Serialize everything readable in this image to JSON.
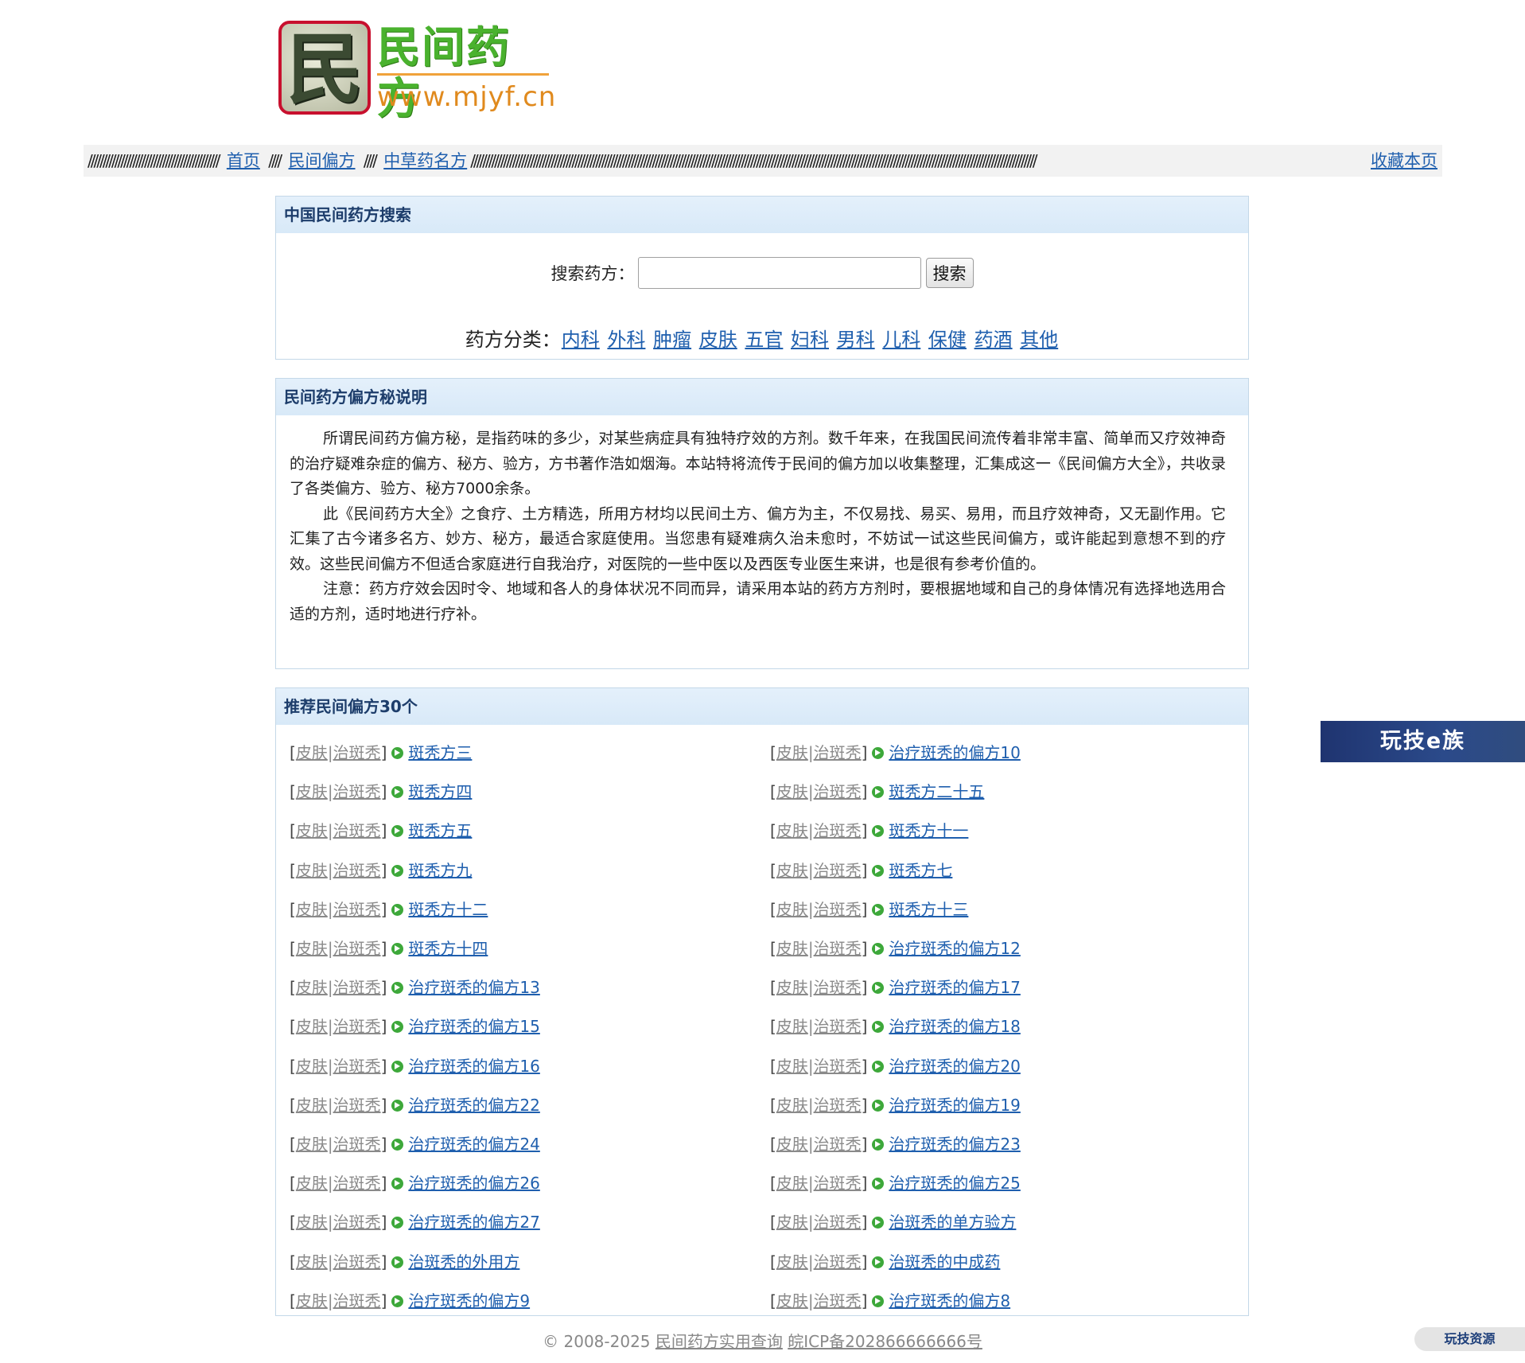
{
  "logo": {
    "char": "民",
    "name": "民间药方",
    "url": "www.mjyf.cn"
  },
  "nav": {
    "slashes_a": "////////////////////////////////////////////",
    "home": "首页",
    "slashes_b": "////",
    "folk_remedies": "民间偏方",
    "slashes_c": "////",
    "herbal": "中草药名方",
    "slashes_d": "//////////////////////////////////////////////////////////////////////////////////////////////////////////////////////////////////////////////////////////////////////////////////////////////",
    "bookmark": "收藏本页"
  },
  "search_panel": {
    "title": "中国民间药方搜索",
    "label": "搜索药方：",
    "input_value": "",
    "button": "搜索",
    "category_label": "药方分类：",
    "categories": [
      "内科",
      "外科",
      "肿瘤",
      "皮肤",
      "五官",
      "妇科",
      "男科",
      "儿科",
      "保健",
      "药酒",
      "其他"
    ]
  },
  "about_panel": {
    "title": "民间药方偏方秘说明",
    "paragraphs": [
      "所谓民间药方偏方秘，是指药味的多少，对某些病症具有独特疗效的方剂。数千年来，在我国民间流传着非常丰富、简单而又疗效神奇的治疗疑难杂症的偏方、秘方、验方，方书著作浩如烟海。本站特将流传于民间的偏方加以收集整理，汇集成这一《民间偏方大全》，共收录了各类偏方、验方、秘方7000余条。",
      "此《民间药方大全》之食疗、土方精选，所用方材均以民间土方、偏方为主，不仅易找、易买、易用，而且疗效神奇，又无副作用。它汇集了古今诸多名方、妙方、秘方，最适合家庭使用。当您患有疑难病久治未愈时，不妨试一试这些民间偏方，或许能起到意想不到的疗效。这些民间偏方不但适合家庭进行自我治疗，对医院的一些中医以及西医专业医生来讲，也是很有参考价值的。",
      "注意：药方疗效会因时令、地域和各人的身体状况不同而异，请采用本站的药方方剂时，要根据地域和自己的身体情况有选择地选用合适的方剂，适时地进行疗补。"
    ]
  },
  "rec_panel": {
    "title": "推荐民间偏方30个",
    "tag_a": "皮肤",
    "tag_sep": "|",
    "tag_b": "治斑秃",
    "bracket_open": "[",
    "bracket_close": "]",
    "left": [
      "斑秃方三",
      "斑秃方四",
      "斑秃方五",
      "斑秃方九",
      "斑秃方十二",
      "斑秃方十四",
      "治疗斑秃的偏方13",
      "治疗斑秃的偏方15",
      "治疗斑秃的偏方16",
      "治疗斑秃的偏方22",
      "治疗斑秃的偏方24",
      "治疗斑秃的偏方26",
      "治疗斑秃的偏方27",
      "治斑秃的外用方",
      "治疗斑秃的偏方9"
    ],
    "right": [
      "治疗斑秃的偏方10",
      "斑秃方二十五",
      "斑秃方十一",
      "斑秃方七",
      "斑秃方十三",
      "治疗斑秃的偏方12",
      "治疗斑秃的偏方17",
      "治疗斑秃的偏方18",
      "治疗斑秃的偏方20",
      "治疗斑秃的偏方19",
      "治疗斑秃的偏方23",
      "治疗斑秃的偏方25",
      "治斑秃的单方验方",
      "治斑秃的中成药",
      "治疗斑秃的偏方8"
    ]
  },
  "side_banner": "玩技e族",
  "corner_badge": "玩技资源",
  "footer": {
    "copyright": "© 2008-2025",
    "site_link": "民间药方实用查询",
    "icp": "皖ICP备202866666666号"
  }
}
